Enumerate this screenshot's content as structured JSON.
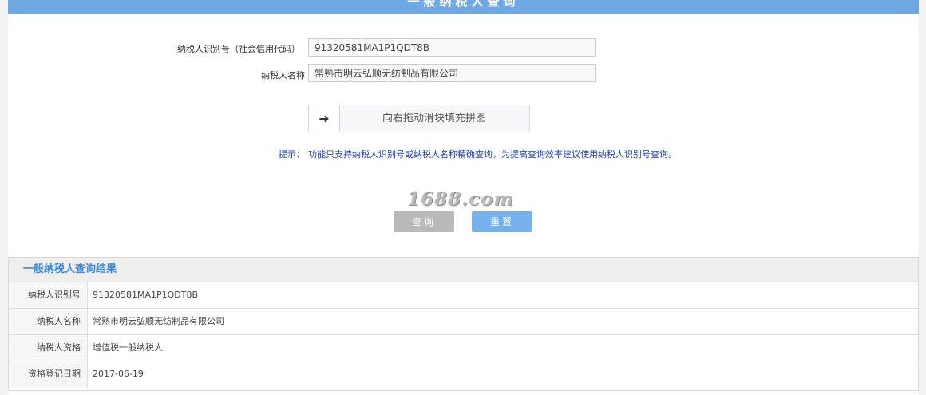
{
  "header": {
    "title": "一般纳税人查询"
  },
  "form": {
    "taxpayer_id_label": "纳税人识别号（社会信用代码）",
    "taxpayer_id_value": "91320581MA1P1QDT8B",
    "taxpayer_name_label": "纳税人名称",
    "taxpayer_name_value": "常熟市明云弘顺无纺制品有限公司"
  },
  "slider": {
    "handle_glyph": "➜",
    "text": "向右拖动滑块填充拼图"
  },
  "hint": {
    "label": "提示：",
    "text": "功能只支持纳税人识别号或纳税人名称精确查询，为提高查询效率建议使用纳税人识别号查询。"
  },
  "watermark": "1688.com",
  "buttons": {
    "query": "查询",
    "reset": "重置"
  },
  "results": {
    "title": "一般纳税人查询结果",
    "rows": [
      {
        "label": "纳税人识别号",
        "value": "91320581MA1P1QDT8B"
      },
      {
        "label": "纳税人名称",
        "value": "常熟市明云弘顺无纺制品有限公司"
      },
      {
        "label": "纳税人资格",
        "value": "增值税一般纳税人"
      },
      {
        "label": "资格登记日期",
        "value": "2017-06-19"
      }
    ]
  }
}
